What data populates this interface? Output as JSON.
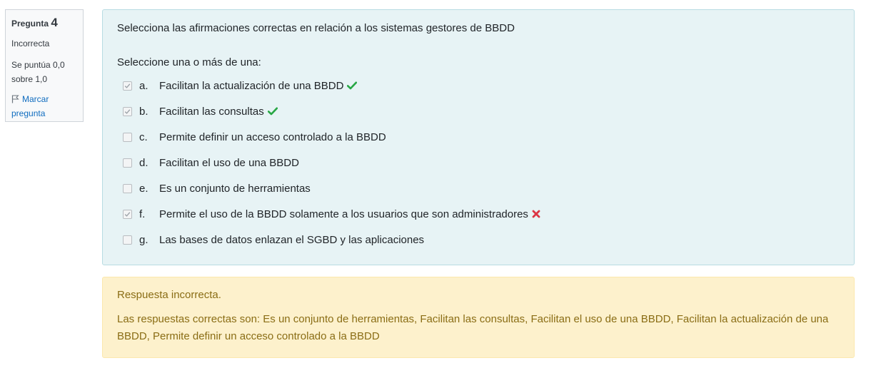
{
  "info": {
    "question_label": "Pregunta",
    "question_number": "4",
    "state": "Incorrecta",
    "grade": "Se puntúa 0,0 sobre 1,0",
    "flag_label": "Marcar pregunta"
  },
  "question": {
    "text": "Selecciona las afirmaciones correctas en relación a los sistemas gestores de BBDD",
    "prompt": "Seleccione una o más de una:",
    "options": [
      {
        "letter": "a.",
        "text": "Facilitan la actualización de una BBDD",
        "checked": true,
        "feedback": "correct"
      },
      {
        "letter": "b.",
        "text": "Facilitan las consultas",
        "checked": true,
        "feedback": "correct"
      },
      {
        "letter": "c.",
        "text": "Permite definir un acceso controlado a la BBDD",
        "checked": false,
        "feedback": ""
      },
      {
        "letter": "d.",
        "text": "Facilitan el uso de una BBDD",
        "checked": false,
        "feedback": ""
      },
      {
        "letter": "e.",
        "text": "Es un conjunto de herramientas",
        "checked": false,
        "feedback": ""
      },
      {
        "letter": "f.",
        "text": "Permite el uso de la BBDD solamente a los usuarios que son administradores",
        "checked": true,
        "feedback": "incorrect"
      },
      {
        "letter": "g.",
        "text": "Las bases de datos enlazan el SGBD y las aplicaciones",
        "checked": false,
        "feedback": ""
      }
    ]
  },
  "outcome": {
    "feedback": "Respuesta incorrecta.",
    "right_answer": "Las respuestas correctas son: Es un conjunto de herramientas, Facilitan las consultas, Facilitan el uso de una BBDD, Facilitan la actualización de una BBDD, Permite definir un acceso controlado a la BBDD"
  },
  "colors": {
    "correct": "#28a745",
    "incorrect": "#dc3545",
    "info_bg": "#e7f3f5",
    "outcome_bg": "#fdf1cc",
    "outcome_text": "#8a6d15"
  }
}
